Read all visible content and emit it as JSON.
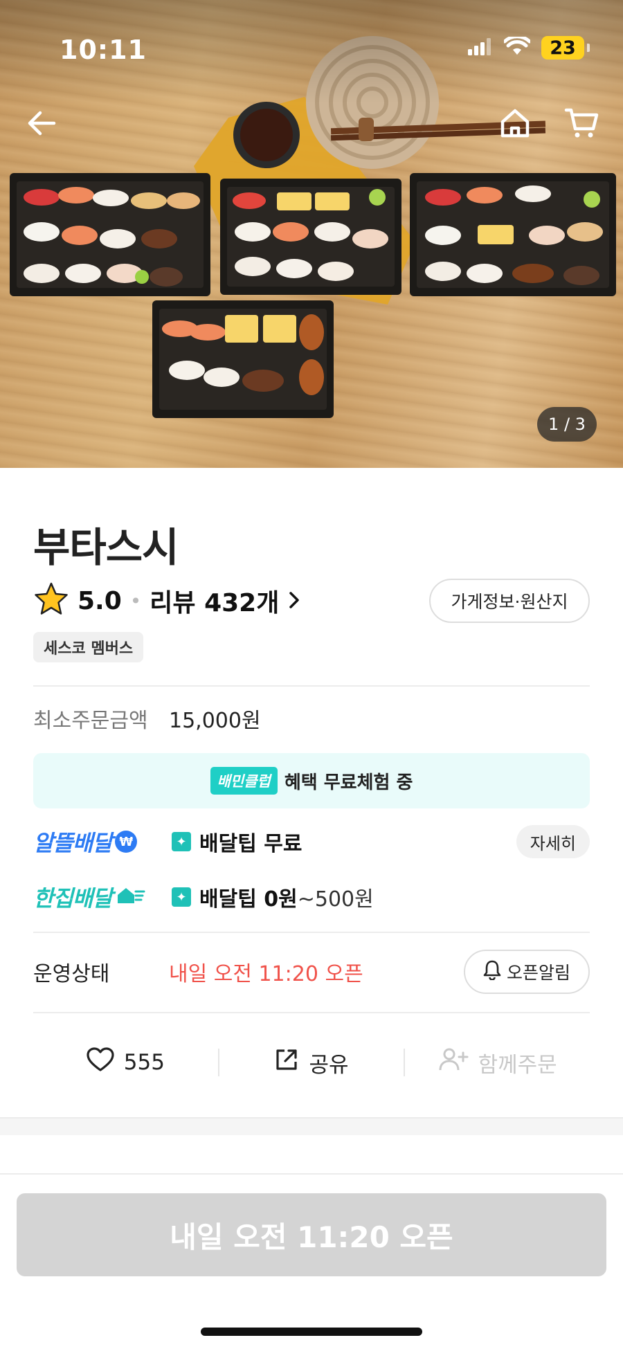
{
  "status_bar": {
    "time": "10:11",
    "battery": "23",
    "signal_icon": "cellular-signal-icon",
    "wifi_icon": "wifi-icon"
  },
  "hero": {
    "page_indicator": "1 / 3",
    "back_icon": "back-arrow-icon",
    "home_icon": "home-icon",
    "cart_icon": "cart-icon"
  },
  "store": {
    "name": "부타스시",
    "rating": "5.0",
    "review_text": "리뷰 432개",
    "info_button": "가게정보·원산지",
    "member_badge": "세스코 멤버스"
  },
  "order": {
    "min_label": "최소주문금액",
    "min_value": "15,000원"
  },
  "club": {
    "badge": "배민클럽",
    "text": "혜택 무료체험 중"
  },
  "delivery": {
    "economy": {
      "logo": "알뜰배달",
      "tip": "배달팁 무료",
      "detail_button": "자세히"
    },
    "single": {
      "logo": "한집배달",
      "tip": "배달팁 0원",
      "tip_range": "~500원"
    }
  },
  "operation": {
    "label": "운영상태",
    "value": "내일 오전 11:20 오픈",
    "alarm_button": "오픈알림"
  },
  "actions": {
    "like_count": "555",
    "share_label": "공유",
    "group_order_label": "함께주문"
  },
  "bottom_button": "내일 오전 11:20 오픈",
  "colors": {
    "accent_red": "#f0524a",
    "teal": "#1fc1b7",
    "blue": "#2d7bf4",
    "battery_yellow": "#ffd21f"
  }
}
